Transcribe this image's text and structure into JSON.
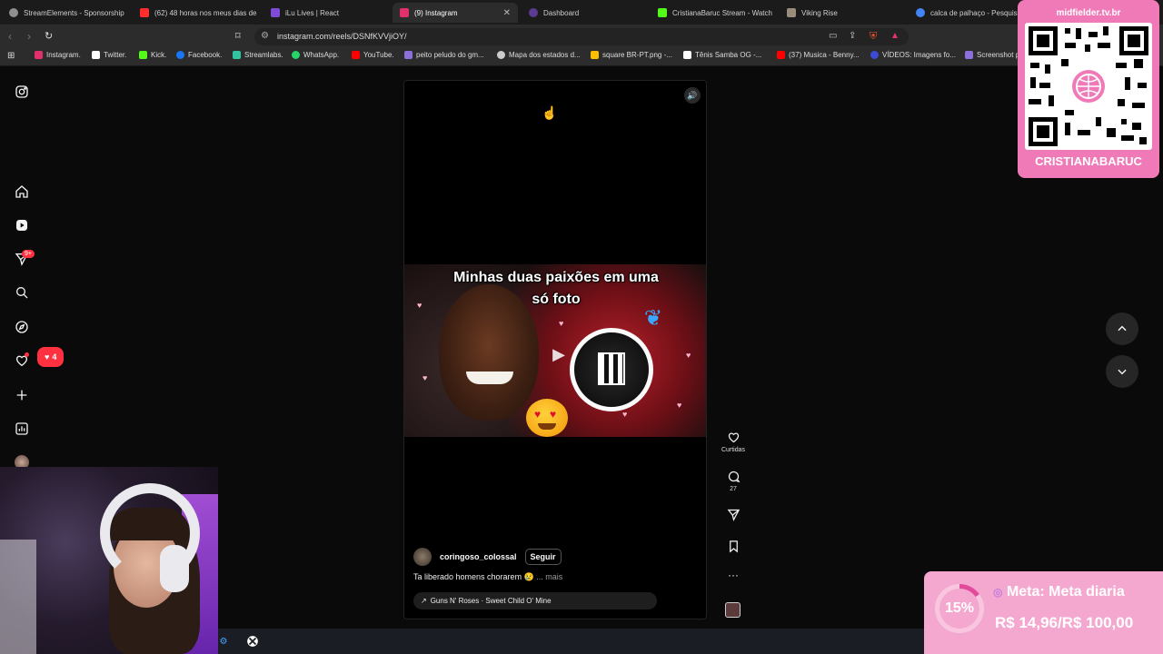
{
  "browser": {
    "tabs": [
      {
        "title": "StreamElements - Sponsorship",
        "icon": "streamelements-icon",
        "color": "#8f8f8f"
      },
      {
        "title": "(62) 48 horas nos meus dias de",
        "icon": "youtube-icon",
        "color": "#ff2d2d"
      },
      {
        "title": "iLu Lives | React",
        "icon": "ilu-icon",
        "color": "#7d4bd6"
      },
      {
        "title": "(9) Instagram",
        "icon": "instagram-icon",
        "color": "#e1306c",
        "active": true
      },
      {
        "title": "Dashboard",
        "icon": "dashboard-icon",
        "color": "#5b3a8f"
      },
      {
        "title": "CristianaBaruc Stream - Watch",
        "icon": "kick-icon",
        "color": "#53fc18"
      },
      {
        "title": "Viking Rise",
        "icon": "viking-rise-icon",
        "color": "#9a8c7a"
      },
      {
        "title": "calca de palhaço - Pesquisa",
        "icon": "google-icon",
        "color": "#4285f4"
      }
    ],
    "url": "instagram.com/reels/DSNfKVVjiOY/",
    "bookmarks": [
      {
        "label": "Instagram.",
        "icon": "instagram-icon",
        "color": "#e1306c"
      },
      {
        "label": "Twitter.",
        "icon": "x-icon",
        "color": "#ffffff"
      },
      {
        "label": "Kick.",
        "icon": "kick-icon",
        "color": "#53fc18"
      },
      {
        "label": "Facebook.",
        "icon": "facebook-icon",
        "color": "#1877f2"
      },
      {
        "label": "Streamlabs.",
        "icon": "streamlabs-icon",
        "color": "#31c3a2"
      },
      {
        "label": "WhatsApp.",
        "icon": "whatsapp-icon",
        "color": "#25d366"
      },
      {
        "label": "YouTube.",
        "icon": "youtube-icon",
        "color": "#ff0000"
      },
      {
        "label": "peito peludo do gm...",
        "icon": "link-icon",
        "color": "#8c6fd8"
      },
      {
        "label": "Mapa dos estados d...",
        "icon": "globe-icon",
        "color": "#cccccc"
      },
      {
        "label": "square BR-PT.png -...",
        "icon": "drive-icon",
        "color": "#fbbc04"
      },
      {
        "label": "Tênis Samba OG -...",
        "icon": "adidas-icon",
        "color": "#ffffff"
      },
      {
        "label": "(37) Musica - Benny...",
        "icon": "youtube-icon",
        "color": "#ff0000"
      },
      {
        "label": "VÍDEOS: Imagens fo...",
        "icon": "globe-icon",
        "color": "#3b4bd6"
      },
      {
        "label": "Screenshot p",
        "icon": "link-icon",
        "color": "#8c6fd8"
      }
    ]
  },
  "instagram": {
    "sidebar": {
      "notifications_badge": "9+",
      "likes_popup_count": "4"
    },
    "reel": {
      "overlay_text_line1": "Minhas duas paixões em uma",
      "overlay_text_line2": "só foto",
      "author": "coringoso_colossal",
      "follow_label": "Seguir",
      "caption": "Ta liberado homens chorarem 😢",
      "more_label": "... mais",
      "audio": "Guns N' Roses · Sweet Child O' Mine"
    },
    "actions": {
      "like_label": "Curtidas",
      "comment_count": "27"
    }
  },
  "overlays": {
    "qr_site": "midfielder.tv.br",
    "qr_name": "CRISTIANABARUC",
    "goal_percent": "15%",
    "goal_percent_value": 15,
    "goal_title": "Meta: Meta diaria",
    "goal_amount": "R$ 14,96/R$ 100,00"
  }
}
